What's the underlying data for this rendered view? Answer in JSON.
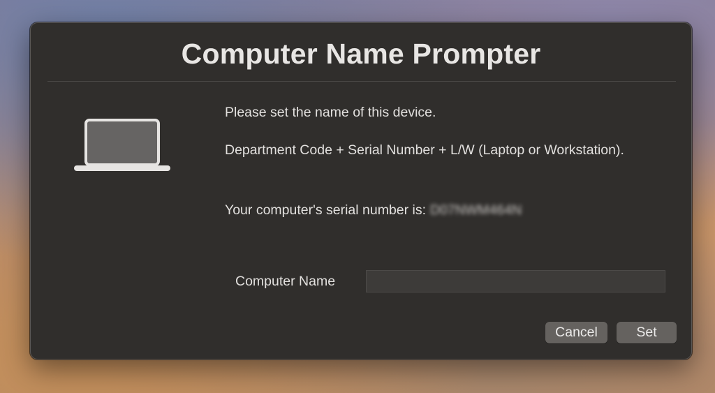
{
  "dialog": {
    "title": "Computer Name Prompter",
    "message_line1": "Please set the name of this device.",
    "message_line2": "Department Code + Serial Number + L/W (Laptop or Workstation).",
    "message_line3_prefix": "Your computer's serial number is:",
    "serial_number": "D07NWM464N",
    "field_label": "Computer Name",
    "field_value": "",
    "field_placeholder": "",
    "cancel_label": "Cancel",
    "set_label": "Set",
    "icon": "laptop-icon"
  }
}
